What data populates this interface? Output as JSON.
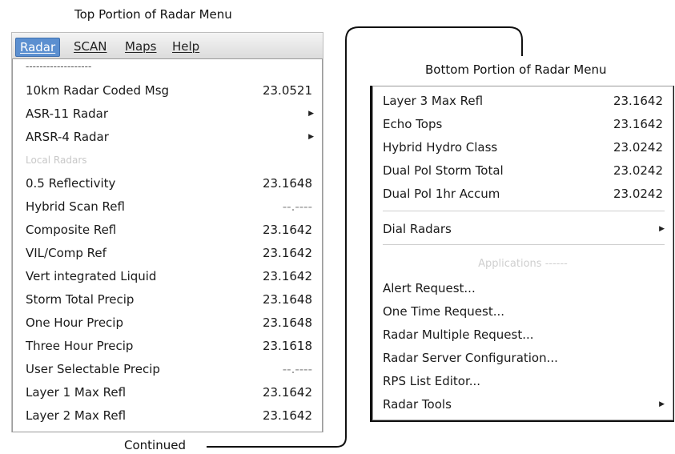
{
  "captions": {
    "top": "Top Portion of Radar Menu",
    "bottom": "Bottom Portion of Radar Menu",
    "continued": "Continued"
  },
  "menubar": {
    "items": [
      "Radar",
      "SCAN",
      "Maps",
      "Help"
    ],
    "active": "Radar"
  },
  "left_menu": {
    "tearoff": "-------------------",
    "rows": [
      {
        "label": "10km Radar Coded Msg",
        "value": "23.0521"
      },
      {
        "label": "ASR-11 Radar",
        "value": ""
      },
      {
        "label": "ARSR-4 Radar",
        "value": ""
      },
      {
        "label": "Local Radars",
        "value": ""
      },
      {
        "label": "0.5 Reflectivity",
        "value": "23.1648"
      },
      {
        "label": "Hybrid Scan Refl",
        "value": "--.----"
      },
      {
        "label": "Composite Refl",
        "value": "23.1642"
      },
      {
        "label": "VIL/Comp Ref",
        "value": "23.1642"
      },
      {
        "label": "Vert integrated Liquid",
        "value": "23.1642"
      },
      {
        "label": "Storm Total Precip",
        "value": "23.1648"
      },
      {
        "label": "One Hour Precip",
        "value": "23.1648"
      },
      {
        "label": "Three Hour Precip",
        "value": "23.1618"
      },
      {
        "label": "User Selectable Precip",
        "value": "--.----"
      },
      {
        "label": "Layer 1 Max Refl",
        "value": "23.1642"
      },
      {
        "label": "Layer 2 Max Refl",
        "value": "23.1642"
      }
    ]
  },
  "right_menu": {
    "rows": [
      {
        "label": "Layer 3 Max Refl",
        "value": "23.1642"
      },
      {
        "label": "Echo Tops",
        "value": "23.1642"
      },
      {
        "label": "Hybrid Hydro Class",
        "value": "23.0242"
      },
      {
        "label": "Dual Pol Storm Total",
        "value": "23.0242"
      },
      {
        "label": "Dual Pol 1hr Accum",
        "value": "23.0242"
      }
    ],
    "dial_radars": "Dial Radars",
    "applications_header": "Applications ------",
    "apps": [
      "Alert Request...",
      "One Time Request...",
      "Radar Multiple Request...",
      "Radar Server Configuration...",
      "RPS List Editor...",
      "Radar Tools"
    ]
  },
  "icons": {
    "submenu_arrow": "triangle-right-icon"
  },
  "colors": {
    "menubar_active": "#5b8fd0",
    "frame_dark": "#111111"
  }
}
